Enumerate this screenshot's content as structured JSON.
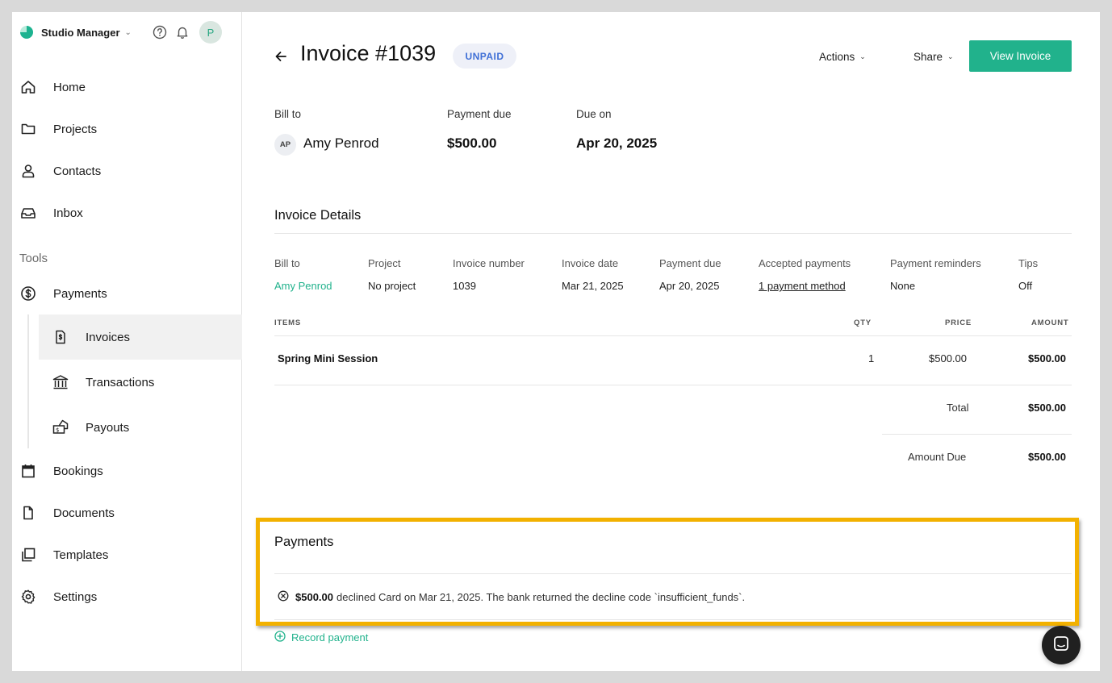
{
  "app": {
    "name": "Studio Manager",
    "avatar_initial": "P"
  },
  "sidebar": {
    "items": [
      {
        "label": "Home",
        "icon": "home-icon"
      },
      {
        "label": "Projects",
        "icon": "folder-icon"
      },
      {
        "label": "Contacts",
        "icon": "person-icon"
      },
      {
        "label": "Inbox",
        "icon": "inbox-icon"
      }
    ],
    "tools_label": "Tools",
    "payments_label": "Payments",
    "sub_items": [
      {
        "label": "Invoices",
        "icon": "invoice-icon",
        "active": true
      },
      {
        "label": "Transactions",
        "icon": "bank-icon",
        "active": false
      },
      {
        "label": "Payouts",
        "icon": "payout-icon",
        "active": false
      }
    ],
    "lower_items": [
      {
        "label": "Bookings",
        "icon": "calendar-icon"
      },
      {
        "label": "Documents",
        "icon": "document-icon"
      },
      {
        "label": "Templates",
        "icon": "templates-icon"
      },
      {
        "label": "Settings",
        "icon": "gear-icon"
      }
    ]
  },
  "header": {
    "title": "Invoice #1039",
    "status_badge": "UNPAID",
    "actions_label": "Actions",
    "share_label": "Share",
    "view_invoice_label": "View Invoice"
  },
  "summary": {
    "bill_to_label": "Bill to",
    "client_initials": "AP",
    "client_name": "Amy Penrod",
    "payment_due_label": "Payment due",
    "payment_due_value": "$500.00",
    "due_on_label": "Due on",
    "due_on_value": "Apr 20, 2025"
  },
  "details": {
    "title": "Invoice Details",
    "columns": [
      {
        "label": "Bill to",
        "value": "Amy Penrod"
      },
      {
        "label": "Project",
        "value": "No project"
      },
      {
        "label": "Invoice number",
        "value": "1039"
      },
      {
        "label": "Invoice date",
        "value": "Mar 21, 2025"
      },
      {
        "label": "Payment due",
        "value": "Apr 20, 2025"
      },
      {
        "label": "Accepted payments",
        "value": "1 payment method"
      },
      {
        "label": "Payment reminders",
        "value": "None"
      },
      {
        "label": "Tips",
        "value": "Off"
      }
    ]
  },
  "items_table": {
    "headers": {
      "items": "ITEMS",
      "qty": "QTY",
      "price": "PRICE",
      "amount": "AMOUNT"
    },
    "rows": [
      {
        "name": "Spring Mini Session",
        "qty": "1",
        "price": "$500.00",
        "amount": "$500.00"
      }
    ],
    "total_label": "Total",
    "total_value": "$500.00",
    "amount_due_label": "Amount Due",
    "amount_due_value": "$500.00"
  },
  "payments": {
    "title": "Payments",
    "entries": [
      {
        "amount": "$500.00",
        "text": "declined Card on Mar 21, 2025. The bank returned the decline code `insufficient_funds`."
      }
    ],
    "record_label": "Record payment"
  },
  "colors": {
    "accent": "#21b28c",
    "badge_text": "#3f6fd6",
    "highlight": "#f2b100"
  }
}
